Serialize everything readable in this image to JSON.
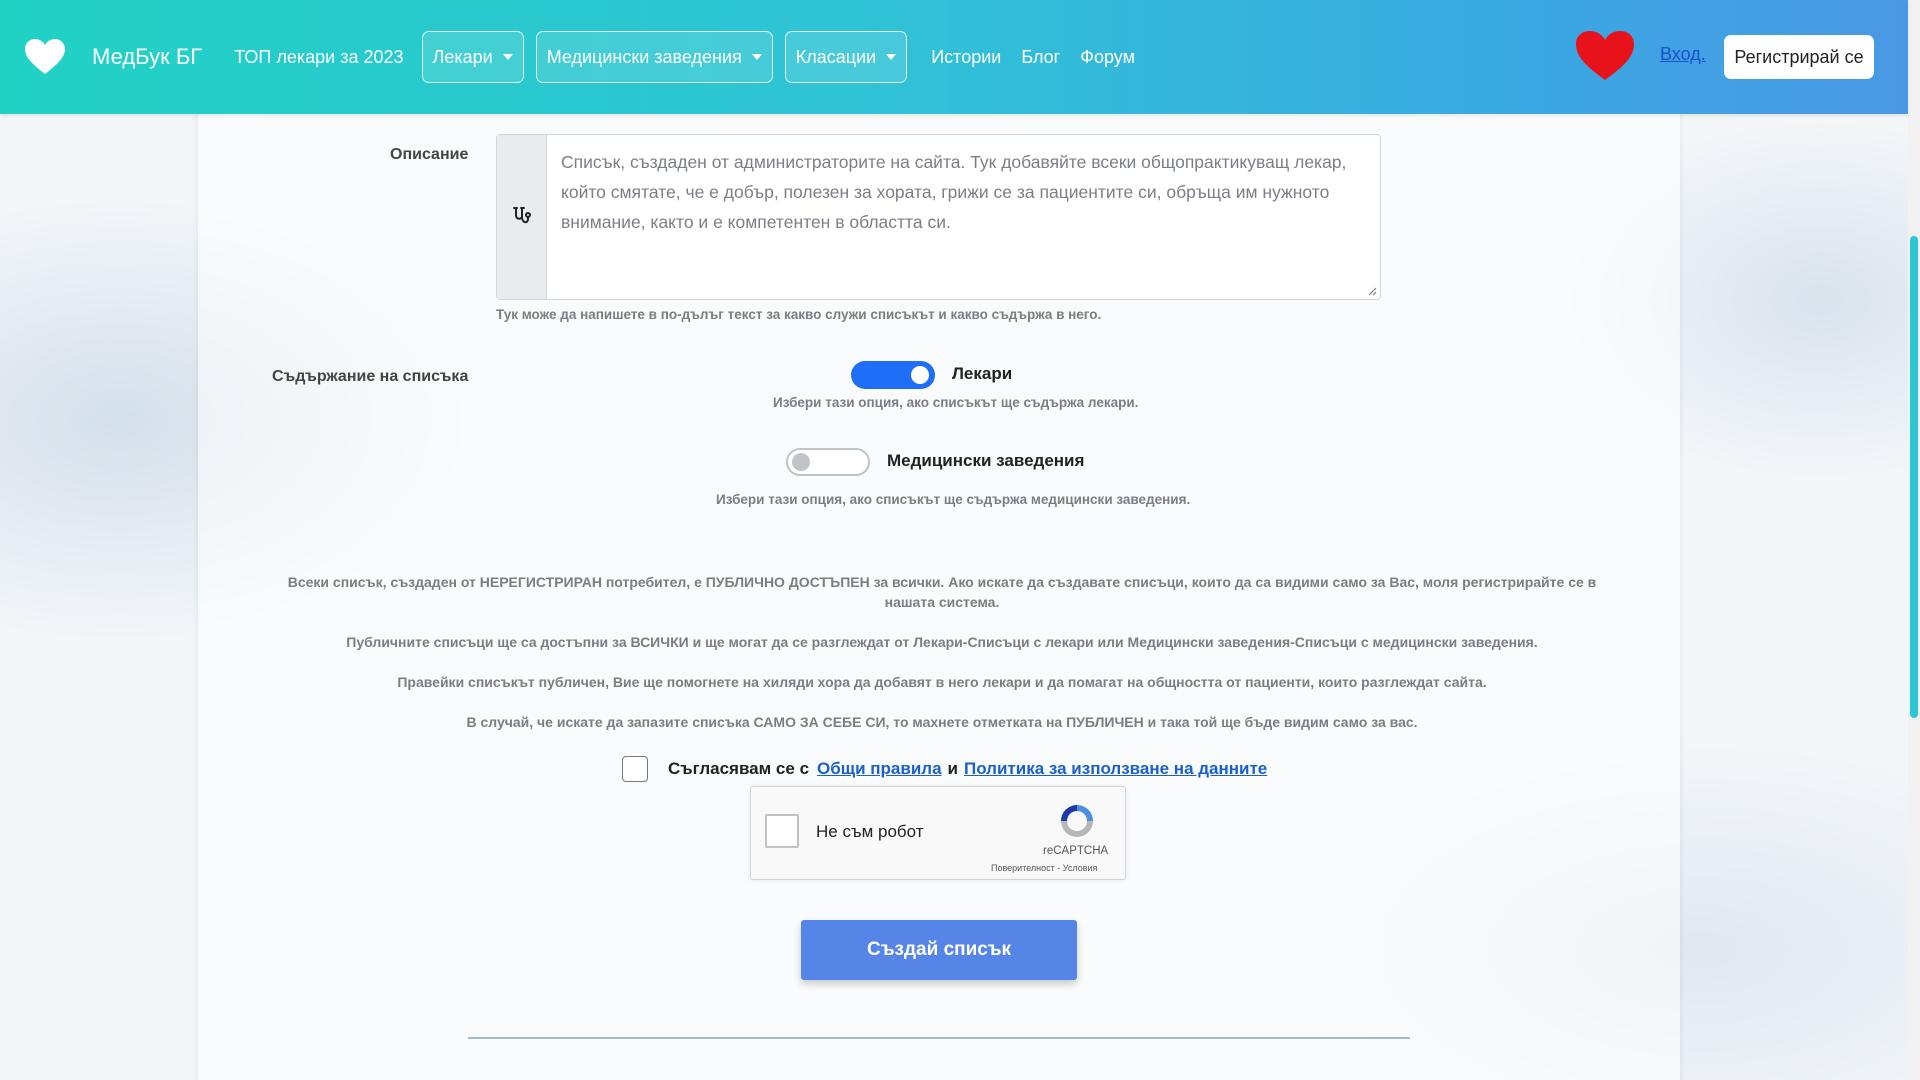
{
  "brand": {
    "name": "МедБук БГ",
    "icon": "heart-icon"
  },
  "nav": {
    "top_link": "ТОП лекари за 2023",
    "dropdowns": [
      "Лекари",
      "Медицински заведения",
      "Класации"
    ],
    "links": [
      "Истории",
      "Блог",
      "Форум"
    ],
    "login": "Вход.",
    "register": "Регистрирай се"
  },
  "form": {
    "description_label": "Описание",
    "description_text": "Списък, създаден от администраторите на сайта. Тук добавяйте всеки общопрактикуващ лекар, който смятате, че е добър, полезен за хората, грижи се за пациентите си, обръща им нужното внимание, както и е компетентен в областта си.",
    "description_help": "Тук може да напишете в по-дълъг текст за какво служи списъкът и какво съдържа в него.",
    "content_label": "Съдържание на списъка",
    "toggle_doctors": {
      "label": "Лекари",
      "help": "Избери тази опция, ако списъкът ще съдържа лекари.",
      "on": true
    },
    "toggle_facilities": {
      "label": "Медицински заведения",
      "help": "Избери тази опция, ако списъкът ще съдържа медицински заведения.",
      "on": false
    }
  },
  "notices": [
    "Всеки списък, създаден от НЕРЕГИСТРИРАН потребител, е ПУБЛИЧНО ДОСТЪПЕН за всички. Ако искате да създавате списъци, които да са видими само за Вас, моля регистрирайте се в нашата система.",
    "Публичните списъци ще са достъпни за ВСИЧКИ и ще могат да се разглеждат от Лекари-Списъци с лекари или Медицински заведения-Списъци с медицински заведения.",
    "Правейки списъкът публичен, Вие ще помогнете на хиляди хора да добавят в него лекари и да помагат на общността от пациенти, които разглеждат сайта.",
    "В случай, че искате да запазите списъка САМО ЗА СЕБЕ СИ, то махнете отметката на ПУБЛИЧЕН и така той ще бъде видим само за вас."
  ],
  "agree": {
    "prefix": "Съгласявам се с",
    "rules_link": "Общи правила",
    "and": "и",
    "policy_link": "Политика за използване на данните"
  },
  "captcha": {
    "label": "Не съм робот",
    "brand": "reCAPTCHA",
    "links": "Поверителност - Условия"
  },
  "submit_label": "Създай списък",
  "colors": {
    "accent": "#1f6ef7",
    "button": "#5685e8",
    "nav_start": "#20d2c4",
    "nav_end": "#4a98e4",
    "heart": "#e8121b"
  }
}
